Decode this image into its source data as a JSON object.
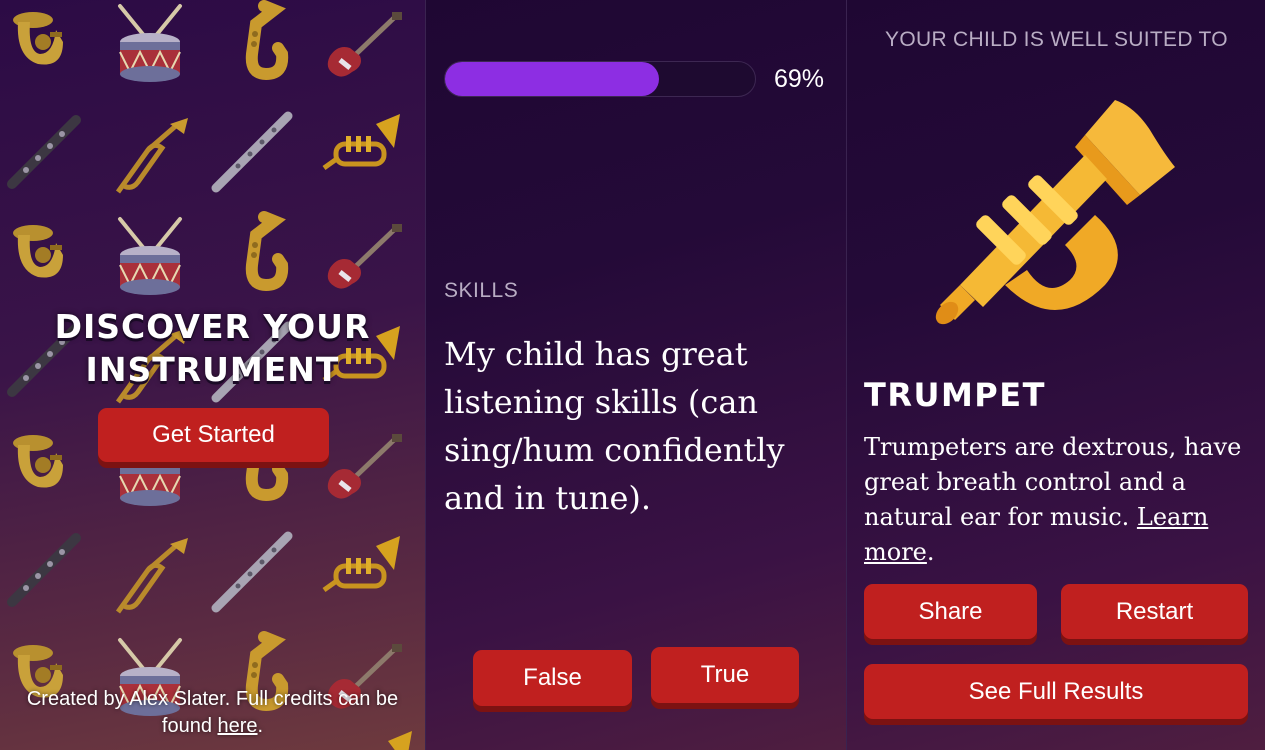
{
  "intro": {
    "title_line1": "DISCOVER YOUR",
    "title_line2": "INSTRUMENT",
    "cta_label": "Get Started",
    "credits_text": "Created by Alex Slater. Full credits can be found ",
    "credits_link": "here",
    "credits_end": ".",
    "pattern_icons": [
      "tuba-icon",
      "drum-icon",
      "saxophone-icon",
      "guitar-icon",
      "clarinet-icon",
      "trombone-icon",
      "flute-icon",
      "trumpet-icon"
    ]
  },
  "quiz": {
    "progress": 0.69,
    "progress_label": "69%",
    "category": "SKILLS",
    "question": "My child has great listening skills (can sing/hum confidently and in tune).",
    "false_label": "False",
    "true_label": "True"
  },
  "result": {
    "header": "YOUR CHILD IS WELL SUITED TO",
    "instrument_icon": "trumpet-icon",
    "name": "TRUMPET",
    "description": "Trumpeters are dextrous, have great breath control and a natural ear for music. ",
    "learn_more": "Learn more",
    "desc_end": ".",
    "share_label": "Share",
    "restart_label": "Restart",
    "full_results_label": "See Full Results"
  },
  "colors": {
    "button": "#c0201f",
    "progress_fill": "#8d2ee3",
    "background": "#240a38"
  }
}
